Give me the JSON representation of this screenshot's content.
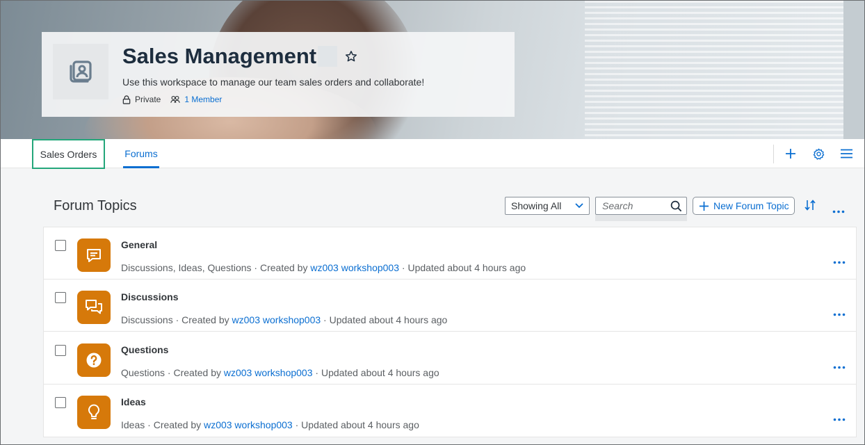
{
  "workspace": {
    "title": "Sales Management",
    "description": "Use this workspace to manage our team sales orders and collaborate!",
    "privacy": "Private",
    "members": "1 Member"
  },
  "tabs": [
    {
      "label": "Sales Orders",
      "active": false,
      "highlighted": true
    },
    {
      "label": "Forums",
      "active": true
    }
  ],
  "toolbar_icons": [
    "plus-icon",
    "gear-icon",
    "menu-icon"
  ],
  "forum": {
    "section_title": "Forum Topics",
    "filter_value": "Showing All",
    "search_placeholder": "Search",
    "new_topic_label": "New Forum Topic"
  },
  "topics": [
    {
      "name": "General",
      "icon": "chat-bubble-icon",
      "types": "Discussions, Ideas, Questions",
      "created_by_prefix": "Created by",
      "creator": "wz003 workshop003",
      "updated": "Updated about 4 hours ago"
    },
    {
      "name": "Discussions",
      "icon": "discussion-icon",
      "types": "Discussions",
      "created_by_prefix": "Created by",
      "creator": "wz003 workshop003",
      "updated": "Updated about 4 hours ago"
    },
    {
      "name": "Questions",
      "icon": "question-icon",
      "types": "Questions",
      "created_by_prefix": "Created by",
      "creator": "wz003 workshop003",
      "updated": "Updated about 4 hours ago"
    },
    {
      "name": "Ideas",
      "icon": "lightbulb-icon",
      "types": "Ideas",
      "created_by_prefix": "Created by",
      "creator": "wz003 workshop003",
      "updated": "Updated about 4 hours ago"
    }
  ],
  "colors": {
    "accent": "#0a6ed1",
    "topic_icon_bg": "#d6790a",
    "tab_highlight": "#23a67a"
  }
}
